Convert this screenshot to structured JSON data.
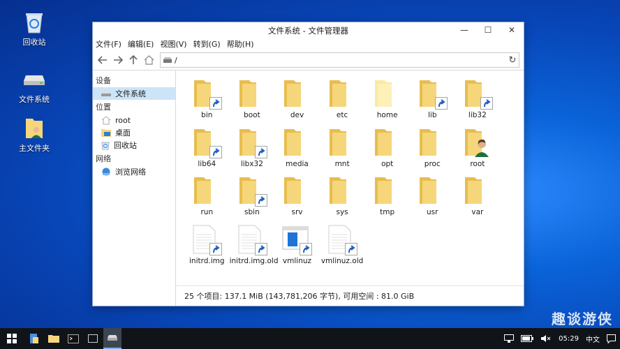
{
  "desktop": {
    "icons": [
      {
        "label": "回收站",
        "icon": "recycle-bin-icon"
      },
      {
        "label": "文件系统",
        "icon": "drive-icon"
      },
      {
        "label": "主文件夹",
        "icon": "home-folder-icon"
      }
    ]
  },
  "window": {
    "title": "文件系统 - 文件管理器",
    "controls": {
      "minimize": "—",
      "maximize": "☐",
      "close": "✕"
    },
    "menu": [
      "文件(F)",
      "编辑(E)",
      "视图(V)",
      "转到(G)",
      "帮助(H)"
    ],
    "address": "/",
    "sidebar": {
      "devices_header": "设备",
      "filesystem": "文件系统",
      "places_header": "位置",
      "root": "root",
      "desktop": "桌面",
      "trash": "回收站",
      "network_header": "网络",
      "browse_network": "浏览网络"
    },
    "files": [
      {
        "name": "bin",
        "type": "link-folder"
      },
      {
        "name": "boot",
        "type": "folder"
      },
      {
        "name": "dev",
        "type": "folder"
      },
      {
        "name": "etc",
        "type": "folder"
      },
      {
        "name": "home",
        "type": "folder-light"
      },
      {
        "name": "lib",
        "type": "link-folder"
      },
      {
        "name": "lib32",
        "type": "link-folder"
      },
      {
        "name": "lib64",
        "type": "link-folder"
      },
      {
        "name": "libx32",
        "type": "link-folder"
      },
      {
        "name": "media",
        "type": "folder"
      },
      {
        "name": "mnt",
        "type": "folder"
      },
      {
        "name": "opt",
        "type": "folder"
      },
      {
        "name": "proc",
        "type": "folder"
      },
      {
        "name": "root",
        "type": "user-folder"
      },
      {
        "name": "run",
        "type": "folder"
      },
      {
        "name": "sbin",
        "type": "link-folder"
      },
      {
        "name": "srv",
        "type": "folder"
      },
      {
        "name": "sys",
        "type": "folder"
      },
      {
        "name": "tmp",
        "type": "folder"
      },
      {
        "name": "usr",
        "type": "folder"
      },
      {
        "name": "var",
        "type": "folder"
      },
      {
        "name": "initrd.img",
        "type": "link-file"
      },
      {
        "name": "initrd.img.old",
        "type": "link-file"
      },
      {
        "name": "vmlinuz",
        "type": "link-kernel"
      },
      {
        "name": "vmlinuz.old",
        "type": "link-file"
      }
    ],
    "status": "25 个项目: 137.1 MiB (143,781,206 字节), 可用空间 : 81.0 GiB"
  },
  "taskbar": {
    "clock": "05:29",
    "ime": "中文",
    "items": [
      "start-icon",
      "files-icon",
      "folder-icon",
      "terminal-icon",
      "window-icon",
      "drive-icon"
    ]
  },
  "watermark": "趣谈游侠",
  "colors": {
    "folder": "#f6d67a",
    "folder_dark": "#e8bd4f",
    "link_arrow": "#1f5fbf",
    "selection": "#cce4f7"
  }
}
